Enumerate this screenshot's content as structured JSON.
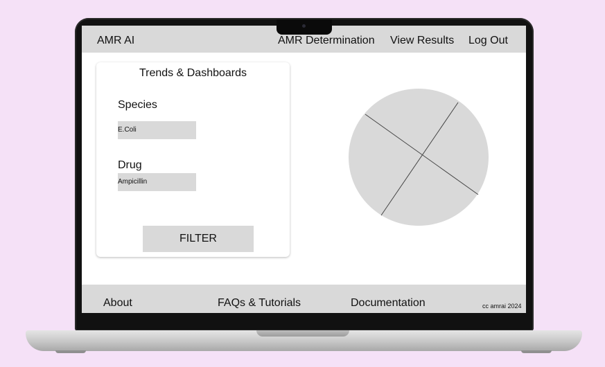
{
  "header": {
    "brand": "AMR AI",
    "nav": [
      "AMR Determination",
      "View Results",
      "Log Out"
    ]
  },
  "panel": {
    "title": "Trends & Dashboards",
    "species_label": "Species",
    "species_value": "E.Coli",
    "drug_label": "Drug",
    "drug_value": "Ampicillin",
    "filter_button": "FILTER"
  },
  "pie_chart": {
    "type": "pie",
    "slices": 4,
    "color": "#d9d9d9",
    "stroke": "#444444"
  },
  "footer": {
    "about": "About",
    "faqs": "FAQs & Tutorials",
    "documentation": "Documentation",
    "copyright": "cc amrai 2024"
  },
  "colors": {
    "background": "#f5e1f7",
    "bar": "#d9d9d9",
    "screen": "#ffffff"
  }
}
